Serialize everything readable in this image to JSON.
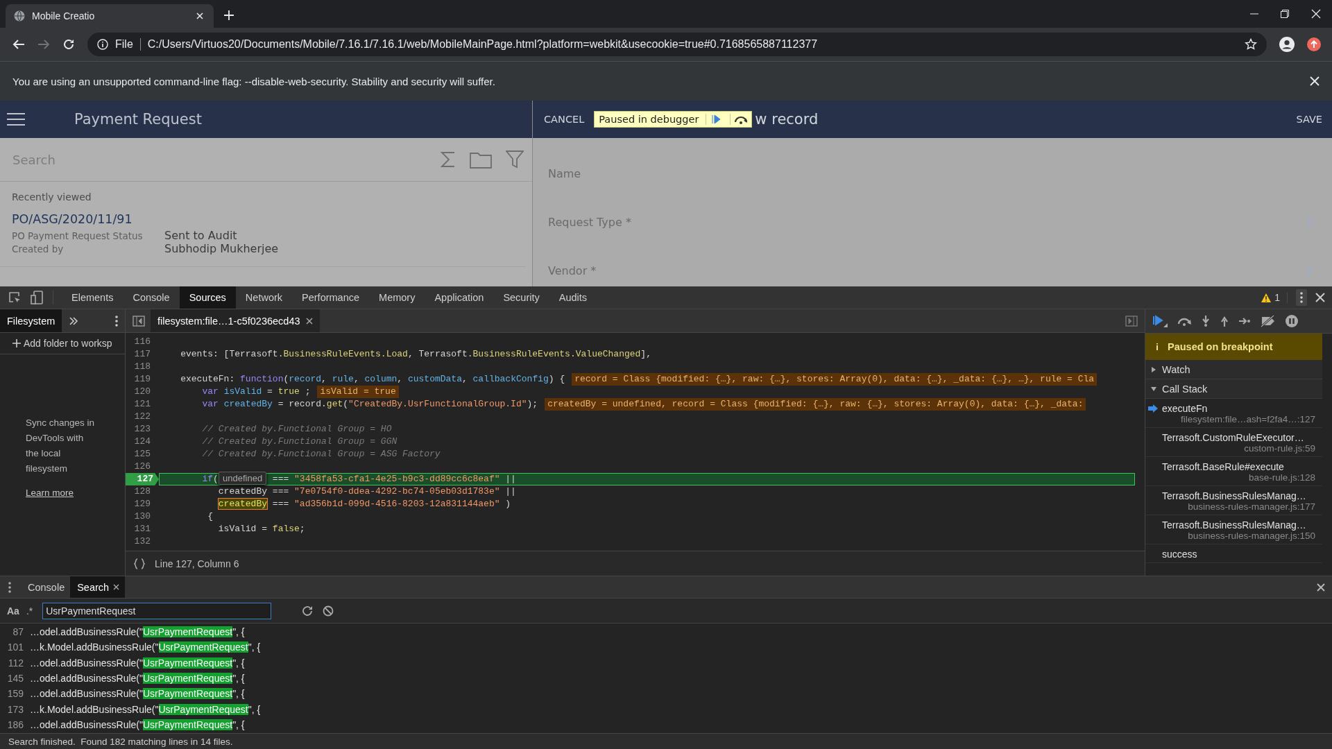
{
  "browser": {
    "tab": {
      "title": "Mobile Creatio"
    },
    "address": {
      "forward_disabled": true,
      "scheme": "File",
      "url": "C:/Users/Virtuos20/Documents/Mobile/7.16.1/7.16.1/web/MobileMainPage.html?platform=webkit&usecookie=true#0.7168565887112377"
    },
    "infobar": {
      "message": "You are using an unsupported command-line flag: --disable-web-security. Stability and security will suffer."
    }
  },
  "app": {
    "list_header": {
      "title": "Payment Request"
    },
    "search": {
      "placeholder": "Search"
    },
    "section_label": "Recently viewed",
    "recent": [
      {
        "title": "PO/ASG/2020/11/91",
        "fields": [
          {
            "label": "PO Payment Request Status",
            "value": "Sent to Audit"
          },
          {
            "label": "Created by",
            "value": "Subhodip Mukherjee"
          }
        ]
      }
    ],
    "edit_header": {
      "cancel": "CANCEL",
      "title": "w record",
      "save": "SAVE"
    },
    "debugger_overlay": {
      "message": "Paused in debugger"
    },
    "form_fields": [
      {
        "label": "Name",
        "lookup": false
      },
      {
        "label": "Request Type *",
        "lookup": true
      },
      {
        "label": "Vendor *",
        "lookup": true
      }
    ]
  },
  "devtools": {
    "tabs": [
      {
        "label": "Elements",
        "selected": false
      },
      {
        "label": "Console",
        "selected": false
      },
      {
        "label": "Sources",
        "selected": true
      },
      {
        "label": "Network",
        "selected": false
      },
      {
        "label": "Performance",
        "selected": false
      },
      {
        "label": "Memory",
        "selected": false
      },
      {
        "label": "Application",
        "selected": false
      },
      {
        "label": "Security",
        "selected": false
      },
      {
        "label": "Audits",
        "selected": false
      }
    ],
    "warnings": "1",
    "navigator": {
      "tabs": [
        {
          "label": "Filesystem",
          "selected": true
        }
      ],
      "add_folder": "Add folder to worksp",
      "sync_message": "Sync changes in DevTools with the local filesystem",
      "learn_more": "Learn more"
    },
    "editor": {
      "file_tab": "filesystem:file…1-c5f0236ecd43",
      "status": "Line 127, Column 6",
      "lines": [
        {
          "number": "116",
          "current": false
        },
        {
          "number": "117",
          "current": false,
          "segments": [
            {
              "kind": "plain",
              "text": "    events: [Terrasoft."
            },
            {
              "kind": "prop",
              "text": "BusinessRuleEvents.Load"
            },
            {
              "kind": "plain",
              "text": ", Terrasoft."
            },
            {
              "kind": "prop",
              "text": "BusinessRuleEvents.ValueChanged"
            },
            {
              "kind": "plain",
              "text": "],"
            }
          ]
        },
        {
          "number": "118",
          "current": false
        },
        {
          "number": "119",
          "current": false,
          "segments": [
            {
              "kind": "plain",
              "text": "    executeFn: "
            },
            {
              "kind": "kw",
              "text": "function"
            },
            {
              "kind": "plain",
              "text": "("
            },
            {
              "kind": "def",
              "text": "record"
            },
            {
              "kind": "plain",
              "text": ", "
            },
            {
              "kind": "def",
              "text": "rule"
            },
            {
              "kind": "plain",
              "text": ", "
            },
            {
              "kind": "def",
              "text": "column"
            },
            {
              "kind": "plain",
              "text": ", "
            },
            {
              "kind": "def",
              "text": "customData"
            },
            {
              "kind": "plain",
              "text": ", "
            },
            {
              "kind": "def",
              "text": "callbackConfig"
            },
            {
              "kind": "plain",
              "text": ") {"
            }
          ],
          "inline_value": "record = Class {modified: {…}, raw: {…}, stores: Array(0), data: {…}, _data: {…}, …}, rule = Cla"
        },
        {
          "number": "120",
          "current": false,
          "segments": [
            {
              "kind": "kw",
              "text": "        var "
            },
            {
              "kind": "def",
              "text": "isValid"
            },
            {
              "kind": "plain",
              "text": " = "
            },
            {
              "kind": "atom",
              "text": "true"
            },
            {
              "kind": "plain",
              "text": " ;"
            }
          ],
          "inline_value": "isValid = true"
        },
        {
          "number": "121",
          "current": false,
          "segments": [
            {
              "kind": "kw",
              "text": "        var "
            },
            {
              "kind": "def",
              "text": "createdBy"
            },
            {
              "kind": "plain",
              "text": " = record."
            },
            {
              "kind": "prop",
              "text": "get"
            },
            {
              "kind": "plain",
              "text": "("
            },
            {
              "kind": "str",
              "text": "\"CreatedBy.UsrFunctionalGroup.Id\""
            },
            {
              "kind": "plain",
              "text": ");"
            }
          ],
          "inline_value": "createdBy = undefined, record = Class {modified: {…}, raw: {…}, stores: Array(0), data: {…}, _data:"
        },
        {
          "number": "122",
          "current": false
        },
        {
          "number": "123",
          "current": false,
          "segments": [
            {
              "kind": "comment",
              "text": "        // Created by.Functional Group = HO"
            }
          ]
        },
        {
          "number": "124",
          "current": false,
          "segments": [
            {
              "kind": "comment",
              "text": "        // Created by.Functional Group = GGN"
            }
          ]
        },
        {
          "number": "125",
          "current": false,
          "segments": [
            {
              "kind": "comment",
              "text": "        // Created by.Functional Group = ASG Factory"
            }
          ]
        },
        {
          "number": "126",
          "current": false
        },
        {
          "number": "127",
          "current": true,
          "segments": [
            {
              "kind": "kw",
              "text": "        if"
            },
            {
              "kind": "plain",
              "text": "(          === "
            },
            {
              "kind": "str",
              "text": "\"3458fa53-cfa1-4e25-b9c3-dd89cc6c8eaf\""
            },
            {
              "kind": "plain",
              "text": " ||"
            }
          ],
          "tooltip": "undefined"
        },
        {
          "number": "128",
          "current": false,
          "segments": [
            {
              "kind": "plain",
              "text": "           createdBy === "
            },
            {
              "kind": "str",
              "text": "\"7e0754f0-ddea-4292-bc74-05eb03d1783e\""
            },
            {
              "kind": "plain",
              "text": " ||"
            }
          ]
        },
        {
          "number": "129",
          "current": false,
          "segments": [
            {
              "kind": "hl",
              "text": "createdBy",
              "indent": true
            },
            {
              "kind": "plain",
              "text": " === "
            },
            {
              "kind": "str",
              "text": "\"ad356b1d-099d-4516-8203-12a831144aeb\""
            },
            {
              "kind": "plain",
              "text": " )"
            }
          ]
        },
        {
          "number": "130",
          "current": false,
          "segments": [
            {
              "kind": "plain",
              "text": "         {"
            }
          ]
        },
        {
          "number": "131",
          "current": false,
          "segments": [
            {
              "kind": "plain",
              "text": "           isValid = "
            },
            {
              "kind": "atom",
              "text": "false"
            },
            {
              "kind": "plain",
              "text": ";"
            }
          ]
        },
        {
          "number": "132",
          "current": false
        }
      ]
    },
    "debugger": {
      "paused_message": "Paused on breakpoint",
      "sections": [
        {
          "label": "Watch",
          "expanded": false
        },
        {
          "label": "Call Stack",
          "expanded": true
        }
      ],
      "call_stack": [
        {
          "function": "executeFn",
          "location": "filesystem:file…ash=f2fa4…:127",
          "selected": true
        },
        {
          "function": "Terrasoft.CustomRuleExecutor…",
          "location": "custom-rule.js:59",
          "selected": false
        },
        {
          "function": "Terrasoft.BaseRule#execute",
          "location": "base-rule.js:128",
          "selected": false
        },
        {
          "function": "Terrasoft.BusinessRulesManag…",
          "location": "business-rules-manager.js:177",
          "selected": false
        },
        {
          "function": "Terrasoft.BusinessRulesManag…",
          "location": "business-rules-manager.js:150",
          "selected": false
        },
        {
          "function": "success",
          "selected": false
        }
      ]
    },
    "drawer": {
      "tabs": [
        {
          "label": "Console",
          "selected": false,
          "closable": false
        },
        {
          "label": "Search",
          "selected": true,
          "closable": true
        }
      ],
      "search": {
        "case_toggle": "Aa",
        "regex_toggle": ".*",
        "value": "UsrPaymentRequest"
      },
      "results": [
        {
          "line": "87",
          "before": "…odel.addBusinessRule(\"",
          "match": "UsrPaymentRequest",
          "after": "\", {"
        },
        {
          "line": "101",
          "before": "…k.Model.addBusinessRule(\"",
          "match": "UsrPaymentRequest",
          "after": "\", {"
        },
        {
          "line": "112",
          "before": "…odel.addBusinessRule(\"",
          "match": "UsrPaymentRequest",
          "after": "\", {"
        },
        {
          "line": "145",
          "before": "…odel.addBusinessRule(\"",
          "match": "UsrPaymentRequest",
          "after": "\", {"
        },
        {
          "line": "159",
          "before": "…odel.addBusinessRule(\"",
          "match": "UsrPaymentRequest",
          "after": "\", {"
        },
        {
          "line": "173",
          "before": "…k.Model.addBusinessRule(\"",
          "match": "UsrPaymentRequest",
          "after": "\", {"
        },
        {
          "line": "186",
          "before": "…odel.addBusinessRule(\"",
          "match": "UsrPaymentRequest",
          "after": "\", {"
        }
      ],
      "status": "Search finished.  Found 182 matching lines in 14 files."
    }
  }
}
